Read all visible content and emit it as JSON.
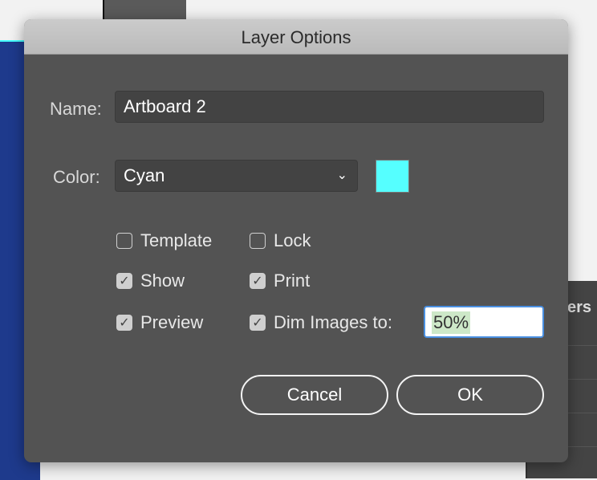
{
  "dialog": {
    "title": "Layer Options"
  },
  "name": {
    "label": "Name:",
    "value": "Artboard 2"
  },
  "color": {
    "label": "Color:",
    "selected": "Cyan",
    "swatch": "#55ffff"
  },
  "options": {
    "template": {
      "label": "Template",
      "checked": false
    },
    "lock": {
      "label": "Lock",
      "checked": false
    },
    "show": {
      "label": "Show",
      "checked": true
    },
    "print": {
      "label": "Print",
      "checked": true
    },
    "preview": {
      "label": "Preview",
      "checked": true
    },
    "dim": {
      "label": "Dim Images to:",
      "checked": true,
      "value": "50%"
    }
  },
  "buttons": {
    "cancel": "Cancel",
    "ok": "OK"
  },
  "background": {
    "panel_tab": "ers"
  }
}
